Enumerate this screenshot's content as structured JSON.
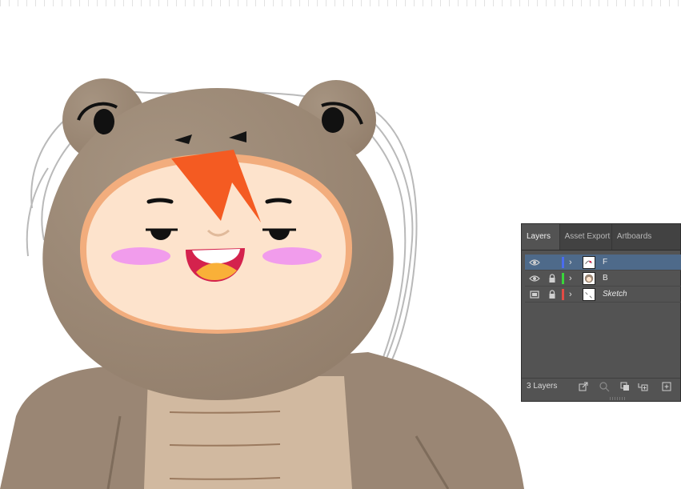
{
  "panel": {
    "tabs": [
      {
        "label": "Layers",
        "active": true
      },
      {
        "label": "Asset Export",
        "active": false
      },
      {
        "label": "Artboards",
        "active": false
      }
    ],
    "layers": [
      {
        "name": "F",
        "color": "#4a6cf0",
        "visible": true,
        "locked": false,
        "selected": true,
        "italic": false
      },
      {
        "name": "B",
        "color": "#39d63a",
        "visible": true,
        "locked": true,
        "selected": false,
        "italic": false
      },
      {
        "name": "Sketch",
        "color": "#e24b45",
        "visible": true,
        "locked": true,
        "selected": false,
        "italic": true
      }
    ],
    "footer": {
      "count": "3 Layers"
    }
  },
  "icons": {
    "visibility": "eye-icon",
    "template": "template-icon",
    "lock": "lock-icon",
    "expand": "chevron-right-icon",
    "export": "export-icon",
    "search": "search-icon",
    "clip": "clipping-mask-icon",
    "sublayer": "new-sublayer-icon",
    "new_layer": "new-layer-icon"
  }
}
